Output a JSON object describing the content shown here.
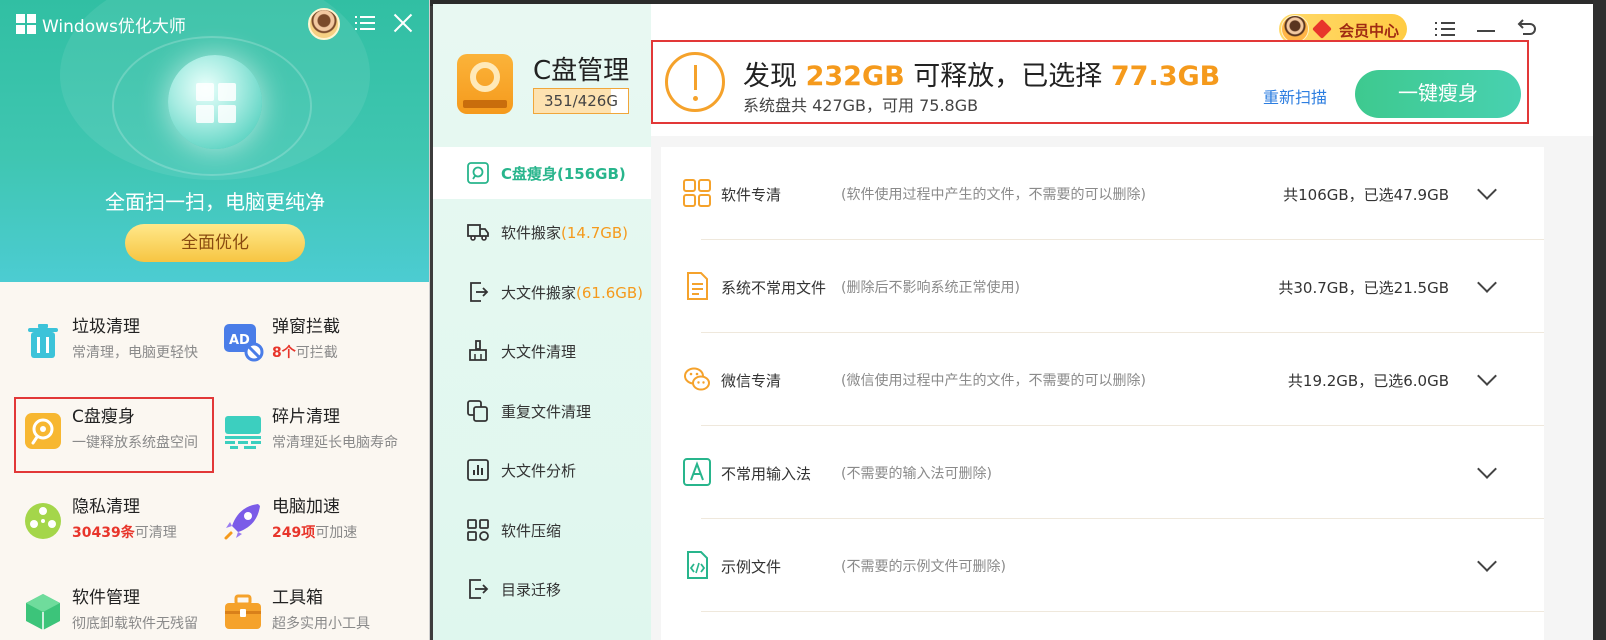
{
  "left_app": {
    "title": "Windows优化大师",
    "slogan": "全面扫一扫，电脑更纯净",
    "optimize_button": "全面优化",
    "tools": [
      {
        "name": "垃圾清理",
        "desc_highlight": "",
        "desc": "常清理，电脑更轻快"
      },
      {
        "name": "弹窗拦截",
        "desc_highlight": "8个",
        "desc": "可拦截"
      },
      {
        "name": "C盘瘦身",
        "desc_highlight": "",
        "desc": "一键释放系统盘空间"
      },
      {
        "name": "碎片清理",
        "desc_highlight": "",
        "desc": "常清理延长电脑寿命"
      },
      {
        "name": "隐私清理",
        "desc_highlight": "30439条",
        "desc": "可清理"
      },
      {
        "name": "电脑加速",
        "desc_highlight": "249项",
        "desc": "可加速"
      },
      {
        "name": "软件管理",
        "desc_highlight": "",
        "desc": "彻底卸载软件无残留"
      },
      {
        "name": "工具箱",
        "desc_highlight": "",
        "desc": "超多实用小工具"
      }
    ]
  },
  "right_app": {
    "disk_title": "C盘管理",
    "disk_usage": "351/426G",
    "disk_usage_fraction": 0.82,
    "vip_label": "会员中心",
    "nav": [
      {
        "label": "C盘瘦身",
        "num": "(156GB)"
      },
      {
        "label": "软件搬家",
        "num": "(14.7GB)"
      },
      {
        "label": "大文件搬家",
        "num": "(61.6GB)"
      },
      {
        "label": "大文件清理",
        "num": ""
      },
      {
        "label": "重复文件清理",
        "num": ""
      },
      {
        "label": "大文件分析",
        "num": ""
      },
      {
        "label": "软件压缩",
        "num": ""
      },
      {
        "label": "目录迁移",
        "num": ""
      }
    ],
    "scan": {
      "prefix": "发现",
      "found": "232GB",
      "middle": "可释放，已选择",
      "selected": "77.3GB",
      "sub": "系统盘共 427GB，可用 75.8GB",
      "rescan": "重新扫描",
      "slim_button": "一键瘦身"
    },
    "rows": [
      {
        "name": "软件专清",
        "desc": "(软件使用过程中产生的文件，不需要的可以删除)",
        "size": "共106GB，已选47.9GB"
      },
      {
        "name": "系统不常用文件",
        "desc": "(删除后不影响系统正常使用)",
        "size": "共30.7GB，已选21.5GB"
      },
      {
        "name": "微信专清",
        "desc": "(微信使用过程中产生的文件，不需要的可以删除)",
        "size": "共19.2GB，已选6.0GB"
      },
      {
        "name": "不常用输入法",
        "desc": "(不需要的输入法可删除)",
        "size": ""
      },
      {
        "name": "示例文件",
        "desc": "(不需要的示例文件可删除)",
        "size": ""
      }
    ]
  },
  "colors": {
    "accent_green": "#28b58c",
    "accent_orange": "#f59a1c",
    "highlight_red": "#e23838",
    "link_blue": "#2d7ee0"
  }
}
